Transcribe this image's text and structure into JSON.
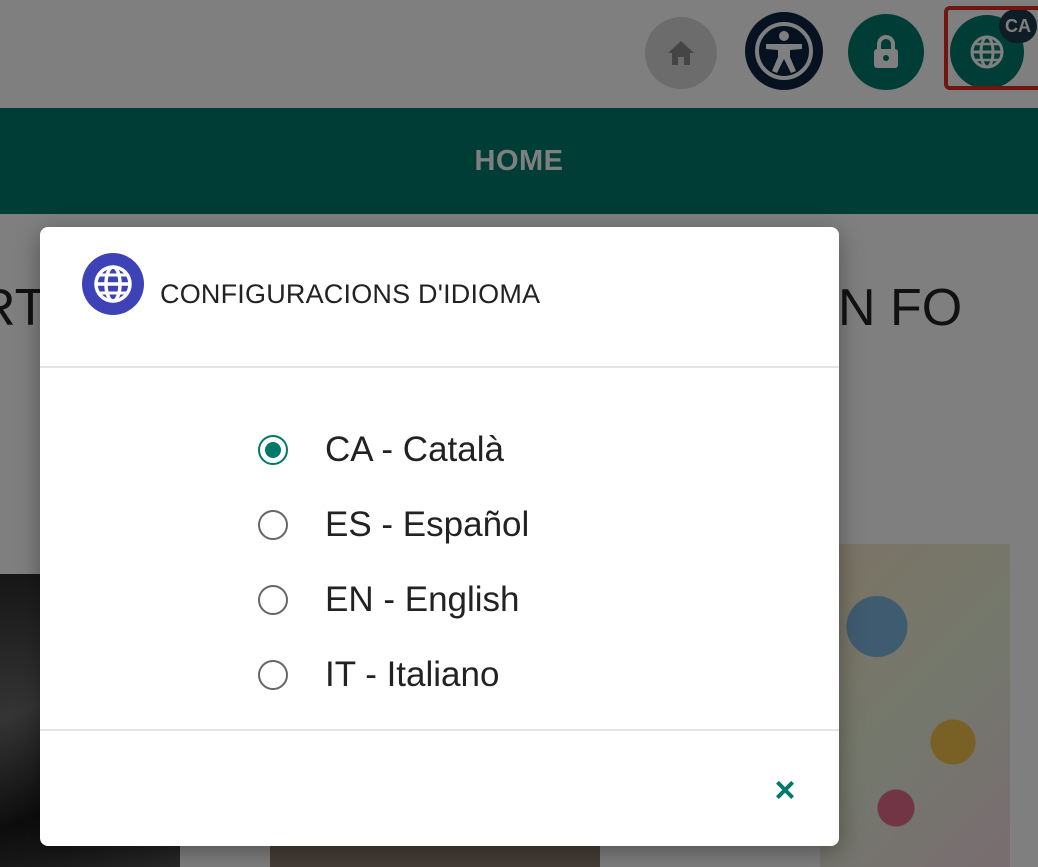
{
  "header": {
    "home_icon": "home-icon",
    "accessibility_icon": "accessibility-icon",
    "lock_icon": "lock-icon",
    "language_icon": "globe-icon",
    "language_badge": "CA"
  },
  "nav": {
    "home_label": "HOME"
  },
  "background": {
    "hero_left": "RT",
    "hero_right": "N FO"
  },
  "modal": {
    "icon": "globe-icon",
    "title": "CONFIGURACIONS D'IDIOMA",
    "options": [
      {
        "label": "CA - Català",
        "selected": true
      },
      {
        "label": "ES - Español",
        "selected": false
      },
      {
        "label": "EN - English",
        "selected": false
      },
      {
        "label": "IT - Italiano",
        "selected": false
      }
    ],
    "close_symbol": "×"
  },
  "colors": {
    "primary": "#007a6c",
    "accessibility": "#0c2444",
    "globe_blue": "#3d43b6",
    "highlight": "#e02a1f"
  }
}
